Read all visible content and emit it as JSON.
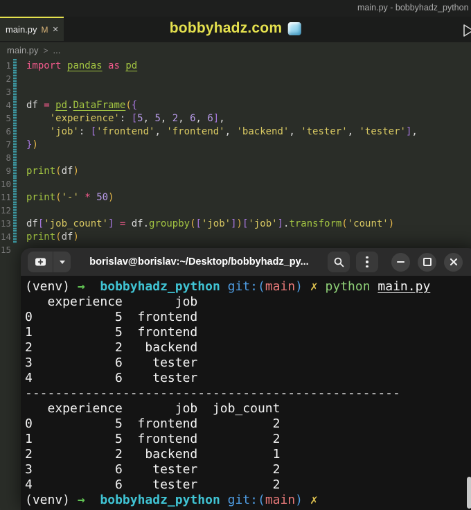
{
  "colors": {
    "accent_yellow": "#e5e14e",
    "tab_modified": "#dcb67a",
    "keyword_pink": "#f35a8c",
    "module_green": "#a3c542",
    "string_yellow": "#d9c962",
    "number_purple": "#b79ae8",
    "paren_gold": "#e8b94a",
    "bracket_violet": "#a878e0",
    "gutter_modified_teal": "#3d9ca6",
    "terminal_arrow_green": "#62c554",
    "terminal_dir_cyan": "#40c4d4",
    "terminal_git_blue": "#4e9be0",
    "terminal_branch_red": "#e87979",
    "terminal_cross_yellow": "#dcc04e",
    "terminal_cmd_green": "#8ed077"
  },
  "window_title": "main.py - bobbyhadz_python",
  "banner": {
    "text": "bobbyhadz.com",
    "icon": "ice-cube"
  },
  "tab": {
    "label": "main.py",
    "modified": "M",
    "close": "✕"
  },
  "breadcrumb": {
    "file": "main.py",
    "chevron": ">",
    "ellipsis": "..."
  },
  "code": {
    "lines": [
      {
        "n": 1,
        "mark": true,
        "toks": [
          [
            "kw",
            "import"
          ],
          [
            "pl",
            " "
          ],
          [
            "mod",
            "pandas"
          ],
          [
            "pl",
            " "
          ],
          [
            "kw",
            "as"
          ],
          [
            "pl",
            " "
          ],
          [
            "mod",
            "pd"
          ]
        ]
      },
      {
        "n": 2,
        "mark": true,
        "toks": []
      },
      {
        "n": 3,
        "mark": true,
        "toks": []
      },
      {
        "n": 4,
        "mark": true,
        "toks": [
          [
            "pl",
            "df "
          ],
          [
            "kw",
            "="
          ],
          [
            "pl",
            " "
          ],
          [
            "mod",
            "pd"
          ],
          [
            "pl",
            "."
          ],
          [
            "mod",
            "DataFrame"
          ],
          [
            "b1",
            "("
          ],
          [
            "b2",
            "{"
          ]
        ]
      },
      {
        "n": 5,
        "mark": true,
        "toks": [
          [
            "pl",
            "    "
          ],
          [
            "str",
            "'experience'"
          ],
          [
            "pl",
            ": "
          ],
          [
            "b2",
            "["
          ],
          [
            "num",
            "5"
          ],
          [
            "pl",
            ", "
          ],
          [
            "num",
            "5"
          ],
          [
            "pl",
            ", "
          ],
          [
            "num",
            "2"
          ],
          [
            "pl",
            ", "
          ],
          [
            "num",
            "6"
          ],
          [
            "pl",
            ", "
          ],
          [
            "num",
            "6"
          ],
          [
            "b2",
            "]"
          ],
          [
            "pl",
            ","
          ]
        ]
      },
      {
        "n": 6,
        "mark": true,
        "toks": [
          [
            "pl",
            "    "
          ],
          [
            "str",
            "'job'"
          ],
          [
            "pl",
            ": "
          ],
          [
            "b2",
            "["
          ],
          [
            "str",
            "'frontend'"
          ],
          [
            "pl",
            ", "
          ],
          [
            "str",
            "'frontend'"
          ],
          [
            "pl",
            ", "
          ],
          [
            "str",
            "'backend'"
          ],
          [
            "pl",
            ", "
          ],
          [
            "str",
            "'tester'"
          ],
          [
            "pl",
            ", "
          ],
          [
            "str",
            "'tester'"
          ],
          [
            "b2",
            "]"
          ],
          [
            "pl",
            ","
          ]
        ]
      },
      {
        "n": 7,
        "mark": true,
        "toks": [
          [
            "b2",
            "}"
          ],
          [
            "b1",
            ")"
          ]
        ]
      },
      {
        "n": 8,
        "mark": true,
        "toks": []
      },
      {
        "n": 9,
        "mark": true,
        "toks": [
          [
            "fn",
            "print"
          ],
          [
            "b1",
            "("
          ],
          [
            "pl",
            "df"
          ],
          [
            "b1",
            ")"
          ]
        ]
      },
      {
        "n": 10,
        "mark": true,
        "toks": []
      },
      {
        "n": 11,
        "mark": true,
        "toks": [
          [
            "fn",
            "print"
          ],
          [
            "b1",
            "("
          ],
          [
            "str",
            "'-'"
          ],
          [
            "pl",
            " "
          ],
          [
            "kw",
            "*"
          ],
          [
            "pl",
            " "
          ],
          [
            "num",
            "50"
          ],
          [
            "b1",
            ")"
          ]
        ]
      },
      {
        "n": 12,
        "mark": true,
        "toks": []
      },
      {
        "n": 13,
        "mark": true,
        "toks": [
          [
            "pl",
            "df"
          ],
          [
            "b2",
            "["
          ],
          [
            "str",
            "'job_count'"
          ],
          [
            "b2",
            "]"
          ],
          [
            "pl",
            " "
          ],
          [
            "kw",
            "="
          ],
          [
            "pl",
            " df."
          ],
          [
            "fn",
            "groupby"
          ],
          [
            "b1",
            "("
          ],
          [
            "b2",
            "["
          ],
          [
            "str",
            "'job'"
          ],
          [
            "b2",
            "]"
          ],
          [
            "b1",
            ")"
          ],
          [
            "b2",
            "["
          ],
          [
            "str",
            "'job'"
          ],
          [
            "b2",
            "]"
          ],
          [
            "pl",
            "."
          ],
          [
            "fn",
            "transform"
          ],
          [
            "b1",
            "("
          ],
          [
            "str",
            "'count'"
          ],
          [
            "b1",
            ")"
          ]
        ]
      },
      {
        "n": 14,
        "mark": true,
        "toks": [
          [
            "fn",
            "print"
          ],
          [
            "b1",
            "("
          ],
          [
            "pl",
            "df"
          ],
          [
            "b1",
            ")"
          ]
        ]
      },
      {
        "n": 15,
        "mark": false,
        "toks": []
      }
    ]
  },
  "terminal": {
    "title": "borislav@borislav:~/Desktop/bobbyhadz_py...",
    "header_icons": {
      "new_tab": "new-tab-plus",
      "dropdown": "chevron-down",
      "search": "magnifier",
      "menu": "kebab-dots",
      "minimize": "minimize-bar",
      "maximize": "maximize-square",
      "close": "close-x"
    },
    "lines": [
      [
        [
          "fg",
          "(venv) "
        ],
        [
          "arrow",
          "→"
        ],
        [
          "fg",
          "  "
        ],
        [
          "dir",
          "bobbyhadz_python"
        ],
        [
          "fg",
          " "
        ],
        [
          "git",
          "git:("
        ],
        [
          "branch",
          "main"
        ],
        [
          "git",
          ")"
        ],
        [
          "fg",
          " "
        ],
        [
          "cross",
          "✗"
        ],
        [
          "fg",
          " "
        ],
        [
          "cmd",
          "python"
        ],
        [
          "fg",
          " "
        ],
        [
          "arg",
          "main.py"
        ]
      ],
      [
        [
          "out",
          "   experience       job"
        ]
      ],
      [
        [
          "out",
          "0           5  frontend"
        ]
      ],
      [
        [
          "out",
          "1           5  frontend"
        ]
      ],
      [
        [
          "out",
          "2           2   backend"
        ]
      ],
      [
        [
          "out",
          "3           6    tester"
        ]
      ],
      [
        [
          "out",
          "4           6    tester"
        ]
      ],
      [
        [
          "out",
          "--------------------------------------------------"
        ]
      ],
      [
        [
          "out",
          "   experience       job  job_count"
        ]
      ],
      [
        [
          "out",
          "0           5  frontend          2"
        ]
      ],
      [
        [
          "out",
          "1           5  frontend          2"
        ]
      ],
      [
        [
          "out",
          "2           2   backend          1"
        ]
      ],
      [
        [
          "out",
          "3           6    tester          2"
        ]
      ],
      [
        [
          "out",
          "4           6    tester          2"
        ]
      ],
      [
        [
          "fg",
          "(venv) "
        ],
        [
          "arrow",
          "→"
        ],
        [
          "fg",
          "  "
        ],
        [
          "dir",
          "bobbyhadz_python"
        ],
        [
          "fg",
          " "
        ],
        [
          "git",
          "git:("
        ],
        [
          "branch",
          "main"
        ],
        [
          "git",
          ")"
        ],
        [
          "fg",
          " "
        ],
        [
          "cross",
          "✗"
        ]
      ]
    ]
  }
}
